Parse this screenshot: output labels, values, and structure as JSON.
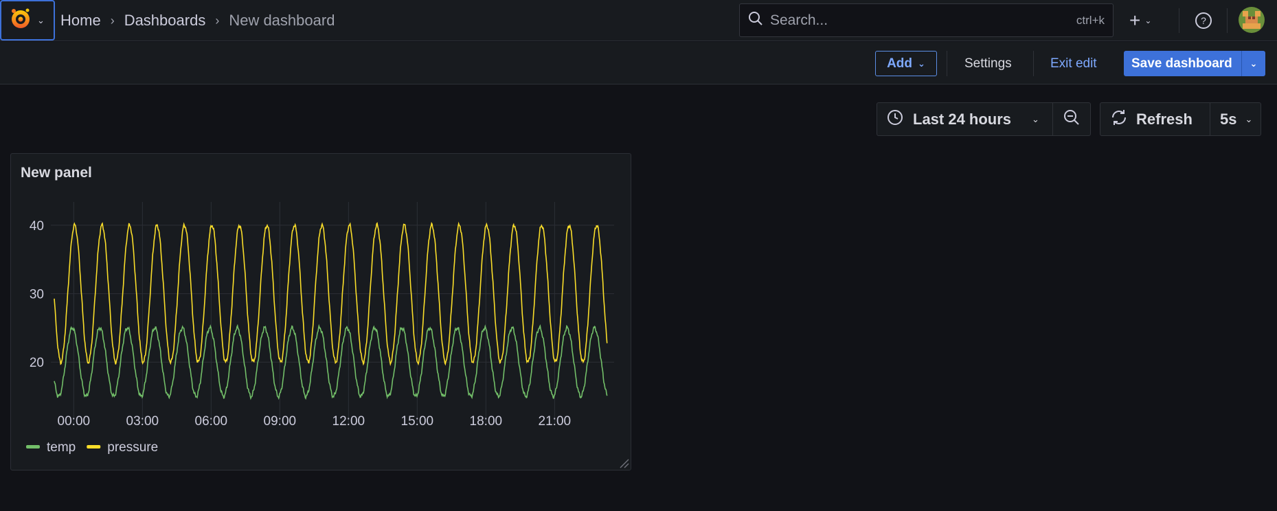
{
  "breadcrumb": {
    "home": "Home",
    "dashboards": "Dashboards",
    "current": "New dashboard"
  },
  "search": {
    "placeholder": "Search...",
    "shortcut": "ctrl+k"
  },
  "toolbar": {
    "add_label": "Add",
    "settings_label": "Settings",
    "exit_label": "Exit edit",
    "save_label": "Save dashboard"
  },
  "time_picker": {
    "range": "Last 24 hours",
    "refresh_label": "Refresh",
    "refresh_interval": "5s"
  },
  "colors": {
    "accent": "#3d71d9",
    "temp": "#73bf69",
    "pressure": "#fade2a"
  },
  "panel": {
    "title": "New panel"
  },
  "chart_data": {
    "type": "line",
    "title": "New panel",
    "x_tick_labels": [
      "00:00",
      "03:00",
      "06:00",
      "09:00",
      "12:00",
      "15:00",
      "18:00",
      "21:00"
    ],
    "x_range_hours": [
      -1,
      23.6
    ],
    "ylim": [
      13,
      43
    ],
    "y_ticks": [
      20,
      30,
      40
    ],
    "grid": true,
    "legend": "bottom-left",
    "series": [
      {
        "name": "temp",
        "color": "#73bf69",
        "mean": 20,
        "amplitude": 5,
        "period_hours": 1.2,
        "phase": 0.3
      },
      {
        "name": "pressure",
        "color": "#fade2a",
        "mean": 30,
        "amplitude": 10,
        "period_hours": 1.2,
        "phase": -0.2
      }
    ]
  }
}
